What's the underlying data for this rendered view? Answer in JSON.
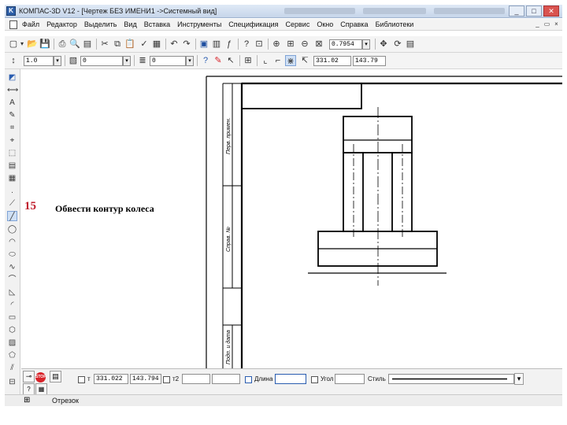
{
  "window": {
    "app_icon_letter": "K",
    "title": "КОМПАС-3D V12 - [Чертеж БЕЗ ИМЕНИ1 ->Системный вид]",
    "minimize": "_",
    "maximize": "□",
    "close": "✕"
  },
  "menu": {
    "items": [
      "Файл",
      "Редактор",
      "Выделить",
      "Вид",
      "Вставка",
      "Инструменты",
      "Спецификация",
      "Сервис",
      "Окно",
      "Справка",
      "Библиотеки"
    ],
    "mdi_minimize": "_",
    "mdi_restore": "▭",
    "mdi_close": "×"
  },
  "toolbar1": {
    "zoom_value": "0.7954",
    "dropdown_arrow": "▾"
  },
  "toolbar2": {
    "line_scale": "1.0",
    "layer": "0",
    "style": "0",
    "coord_x": "331.02",
    "coord_y": "143.79",
    "dropdown_arrow": "▾"
  },
  "canvas": {
    "step_number": "15",
    "instruction": "Обвести контур колеса",
    "stamp_labels": [
      "Перв. примен.",
      "Справ. №",
      "Подп. и дата"
    ]
  },
  "property_bar": {
    "point_label": "т",
    "point_x": "331.022",
    "point_y": "143.794",
    "point2_label": "т2",
    "length_label": "Длина",
    "angle_label": "Угол",
    "style_label": "Стиль"
  },
  "status_bar": {
    "mode": "Отрезок"
  },
  "colors": {
    "accent_red": "#d8232a",
    "step_number": "#c0202f",
    "icon_blue": "#2a5db0"
  }
}
